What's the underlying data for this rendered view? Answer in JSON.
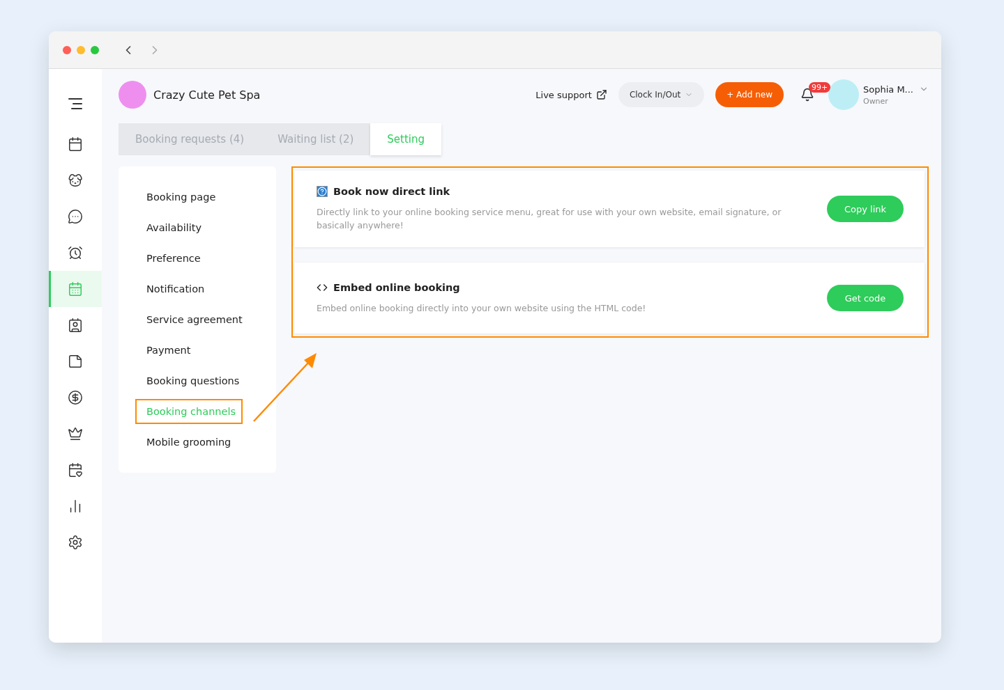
{
  "window": {
    "nav": {
      "back_disabled": false,
      "forward_disabled": true
    }
  },
  "sidebar": {
    "items": [
      {
        "kind": "calendar",
        "selected": false
      },
      {
        "kind": "dog",
        "selected": false
      },
      {
        "kind": "chat",
        "selected": false
      },
      {
        "kind": "alarm",
        "selected": false
      },
      {
        "kind": "booking",
        "selected": true
      },
      {
        "kind": "badge",
        "selected": false
      },
      {
        "kind": "note",
        "selected": false
      },
      {
        "kind": "dollar",
        "selected": false
      },
      {
        "kind": "crown",
        "selected": false
      },
      {
        "kind": "event",
        "selected": false
      },
      {
        "kind": "chart",
        "selected": false
      },
      {
        "kind": "settings",
        "selected": false
      }
    ]
  },
  "header": {
    "business_name": "Crazy Cute Pet Spa",
    "live_support": "Live support",
    "clock": "Clock In/Out",
    "add_new": "+ Add new",
    "notifications": "99+",
    "user": {
      "name": "Sophia M...",
      "role": "Owner"
    }
  },
  "tabs": [
    {
      "label": "Booking requests (4)",
      "selected": false
    },
    {
      "label": "Waiting list (2)",
      "selected": false
    },
    {
      "label": "Setting",
      "selected": true
    }
  ],
  "settings_menu": [
    {
      "label": "Booking page",
      "selected": false
    },
    {
      "label": "Availability",
      "selected": false
    },
    {
      "label": "Preference",
      "selected": false
    },
    {
      "label": "Notification",
      "selected": false
    },
    {
      "label": "Service agreement",
      "selected": false
    },
    {
      "label": "Payment",
      "selected": false
    },
    {
      "label": "Booking questions",
      "selected": false
    },
    {
      "label": "Booking channels",
      "selected": true
    },
    {
      "label": "Mobile grooming",
      "selected": false
    }
  ],
  "channels": [
    {
      "kind": "link",
      "title": "Book now direct link",
      "description": "Directly link to your online booking service menu, great for use with your own website, email signature, or basically anywhere!",
      "button": "Copy link"
    },
    {
      "kind": "embed",
      "title": "Embed online booking",
      "description": "Embed online booking directly into your own website using the HTML code!",
      "button": "Get code"
    }
  ]
}
